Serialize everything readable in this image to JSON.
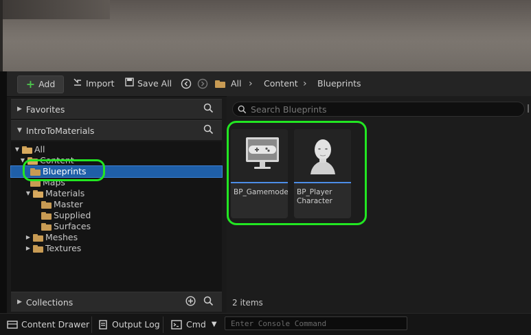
{
  "toolbar": {
    "add_label": "Add",
    "import_label": "Import",
    "save_all_label": "Save All",
    "breadcrumbs": [
      "All",
      "Content",
      "Blueprints"
    ]
  },
  "left_panel": {
    "favorites_label": "Favorites",
    "project_label": "IntroToMaterials",
    "collections_label": "Collections",
    "tree": [
      {
        "label": "All",
        "depth": 0,
        "expanded": true
      },
      {
        "label": "Content",
        "depth": 1,
        "expanded": true
      },
      {
        "label": "Blueprints",
        "depth": 2,
        "selected": true
      },
      {
        "label": "Maps",
        "depth": 2
      },
      {
        "label": "Materials",
        "depth": 2,
        "expanded": true
      },
      {
        "label": "Master",
        "depth": 3
      },
      {
        "label": "Supplied",
        "depth": 3
      },
      {
        "label": "Surfaces",
        "depth": 3
      },
      {
        "label": "Meshes",
        "depth": 2,
        "expanded": false
      },
      {
        "label": "Textures",
        "depth": 2,
        "expanded": false
      }
    ]
  },
  "right_panel": {
    "search_placeholder": "Search Blueprints",
    "assets": [
      {
        "label": "BP_Gamemode",
        "icon": "gamemode-monitor-icon"
      },
      {
        "label": "BP_Player Character",
        "icon": "player-character-icon"
      }
    ],
    "item_count": "2 items"
  },
  "statusbar": {
    "content_drawer_label": "Content Drawer",
    "output_log_label": "Output Log",
    "cmd_label": "Cmd",
    "console_placeholder": "Enter Console Command"
  },
  "colors": {
    "highlight": "#22e622",
    "selection": "#1f5fa8",
    "add_plus": "#4cc24c",
    "folder": "#c89b54",
    "tile_underline": "#4d8ee8"
  }
}
